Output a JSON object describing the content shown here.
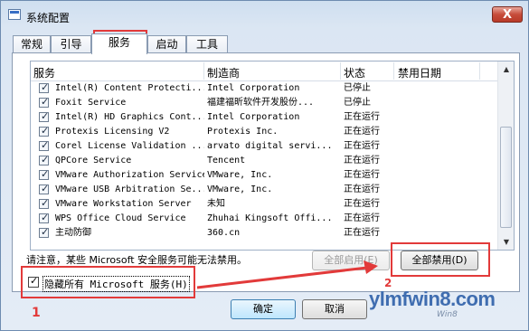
{
  "window": {
    "title": "系统配置",
    "close_label": "X"
  },
  "tabs": [
    "常规",
    "引导",
    "服务",
    "启动",
    "工具"
  ],
  "active_tab": 2,
  "columns": {
    "service": "服务",
    "vendor": "制造商",
    "status": "状态",
    "disabled_date": "禁用日期"
  },
  "services": [
    {
      "name": "Intel(R) Content Protecti...",
      "vendor": "Intel Corporation",
      "status": "已停止",
      "checked": true
    },
    {
      "name": "Foxit Service",
      "vendor": "福建福昕软件开发股份...",
      "status": "已停止",
      "checked": true
    },
    {
      "name": "Intel(R) HD Graphics Cont...",
      "vendor": "Intel Corporation",
      "status": "正在运行",
      "checked": true
    },
    {
      "name": "Protexis Licensing V2",
      "vendor": "Protexis Inc.",
      "status": "正在运行",
      "checked": true
    },
    {
      "name": "Corel License Validation ...",
      "vendor": "arvato digital servi...",
      "status": "正在运行",
      "checked": true
    },
    {
      "name": "QPCore Service",
      "vendor": "Tencent",
      "status": "正在运行",
      "checked": true
    },
    {
      "name": "VMware Authorization Service",
      "vendor": "VMware, Inc.",
      "status": "正在运行",
      "checked": true
    },
    {
      "name": "VMware USB Arbitration Se...",
      "vendor": "VMware, Inc.",
      "status": "正在运行",
      "checked": true
    },
    {
      "name": "VMware Workstation Server",
      "vendor": "未知",
      "status": "正在运行",
      "checked": true
    },
    {
      "name": "WPS Office Cloud Service",
      "vendor": "Zhuhai Kingsoft Offi...",
      "status": "正在运行",
      "checked": true
    },
    {
      "name": "主动防御",
      "vendor": "360.cn",
      "status": "正在运行",
      "checked": true
    }
  ],
  "note": "请注意，某些 Microsoft 安全服务可能无法禁用。",
  "buttons": {
    "enable_all": "全部启用(E)",
    "disable_all": "全部禁用(D)",
    "ok": "确定",
    "cancel": "取消"
  },
  "hide_ms": {
    "label": "隐藏所有 Microsoft 服务(H)",
    "checked": true
  },
  "annotations": {
    "step1": "1",
    "step2": "2"
  },
  "watermark": {
    "text": "ylmfwin8.com",
    "sub": "Win8"
  }
}
